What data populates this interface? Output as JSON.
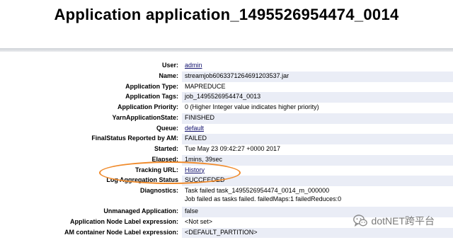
{
  "title": "Application application_1495526954474_0014",
  "rows": [
    {
      "label": "User:",
      "value": "admin",
      "link": true
    },
    {
      "label": "Name:",
      "value": "streamjob6063371264691203537.jar"
    },
    {
      "label": "Application Type:",
      "value": "MAPREDUCE"
    },
    {
      "label": "Application Tags:",
      "value": "job_1495526954474_0013"
    },
    {
      "label": "Application Priority:",
      "value": "0 (Higher Integer value indicates higher priority)"
    },
    {
      "label": "YarnApplicationState:",
      "value": "FINISHED"
    },
    {
      "label": "Queue:",
      "value": "default",
      "link": true
    },
    {
      "label": "FinalStatus Reported by AM:",
      "value": "FAILED"
    },
    {
      "label": "Started:",
      "value": "Tue May 23 09:42:27 +0000 2017"
    },
    {
      "label": "Elapsed:",
      "value": "1mins, 39sec"
    },
    {
      "label": "Tracking URL:",
      "value": "History",
      "link": true
    },
    {
      "label": "Log Aggregation Status",
      "value": "SUCCEEDED"
    },
    {
      "label": "Diagnostics:",
      "value": "Task failed task_1495526954474_0014_m_000000",
      "value2": "Job failed as tasks failed. failedMaps:1 failedReduces:0"
    },
    {
      "label": "Unmanaged Application:",
      "value": "false"
    },
    {
      "label": "Application Node Label expression:",
      "value": "<Not set>"
    },
    {
      "label": "AM container Node Label expression:",
      "value": "<DEFAULT_PARTITION>"
    }
  ],
  "watermark": "dotNET跨平台",
  "watermark_icon": "wechat-icon",
  "colors": {
    "row_alt": "#eaedf6",
    "link": "#10106e",
    "highlight": "#f08a2a"
  }
}
